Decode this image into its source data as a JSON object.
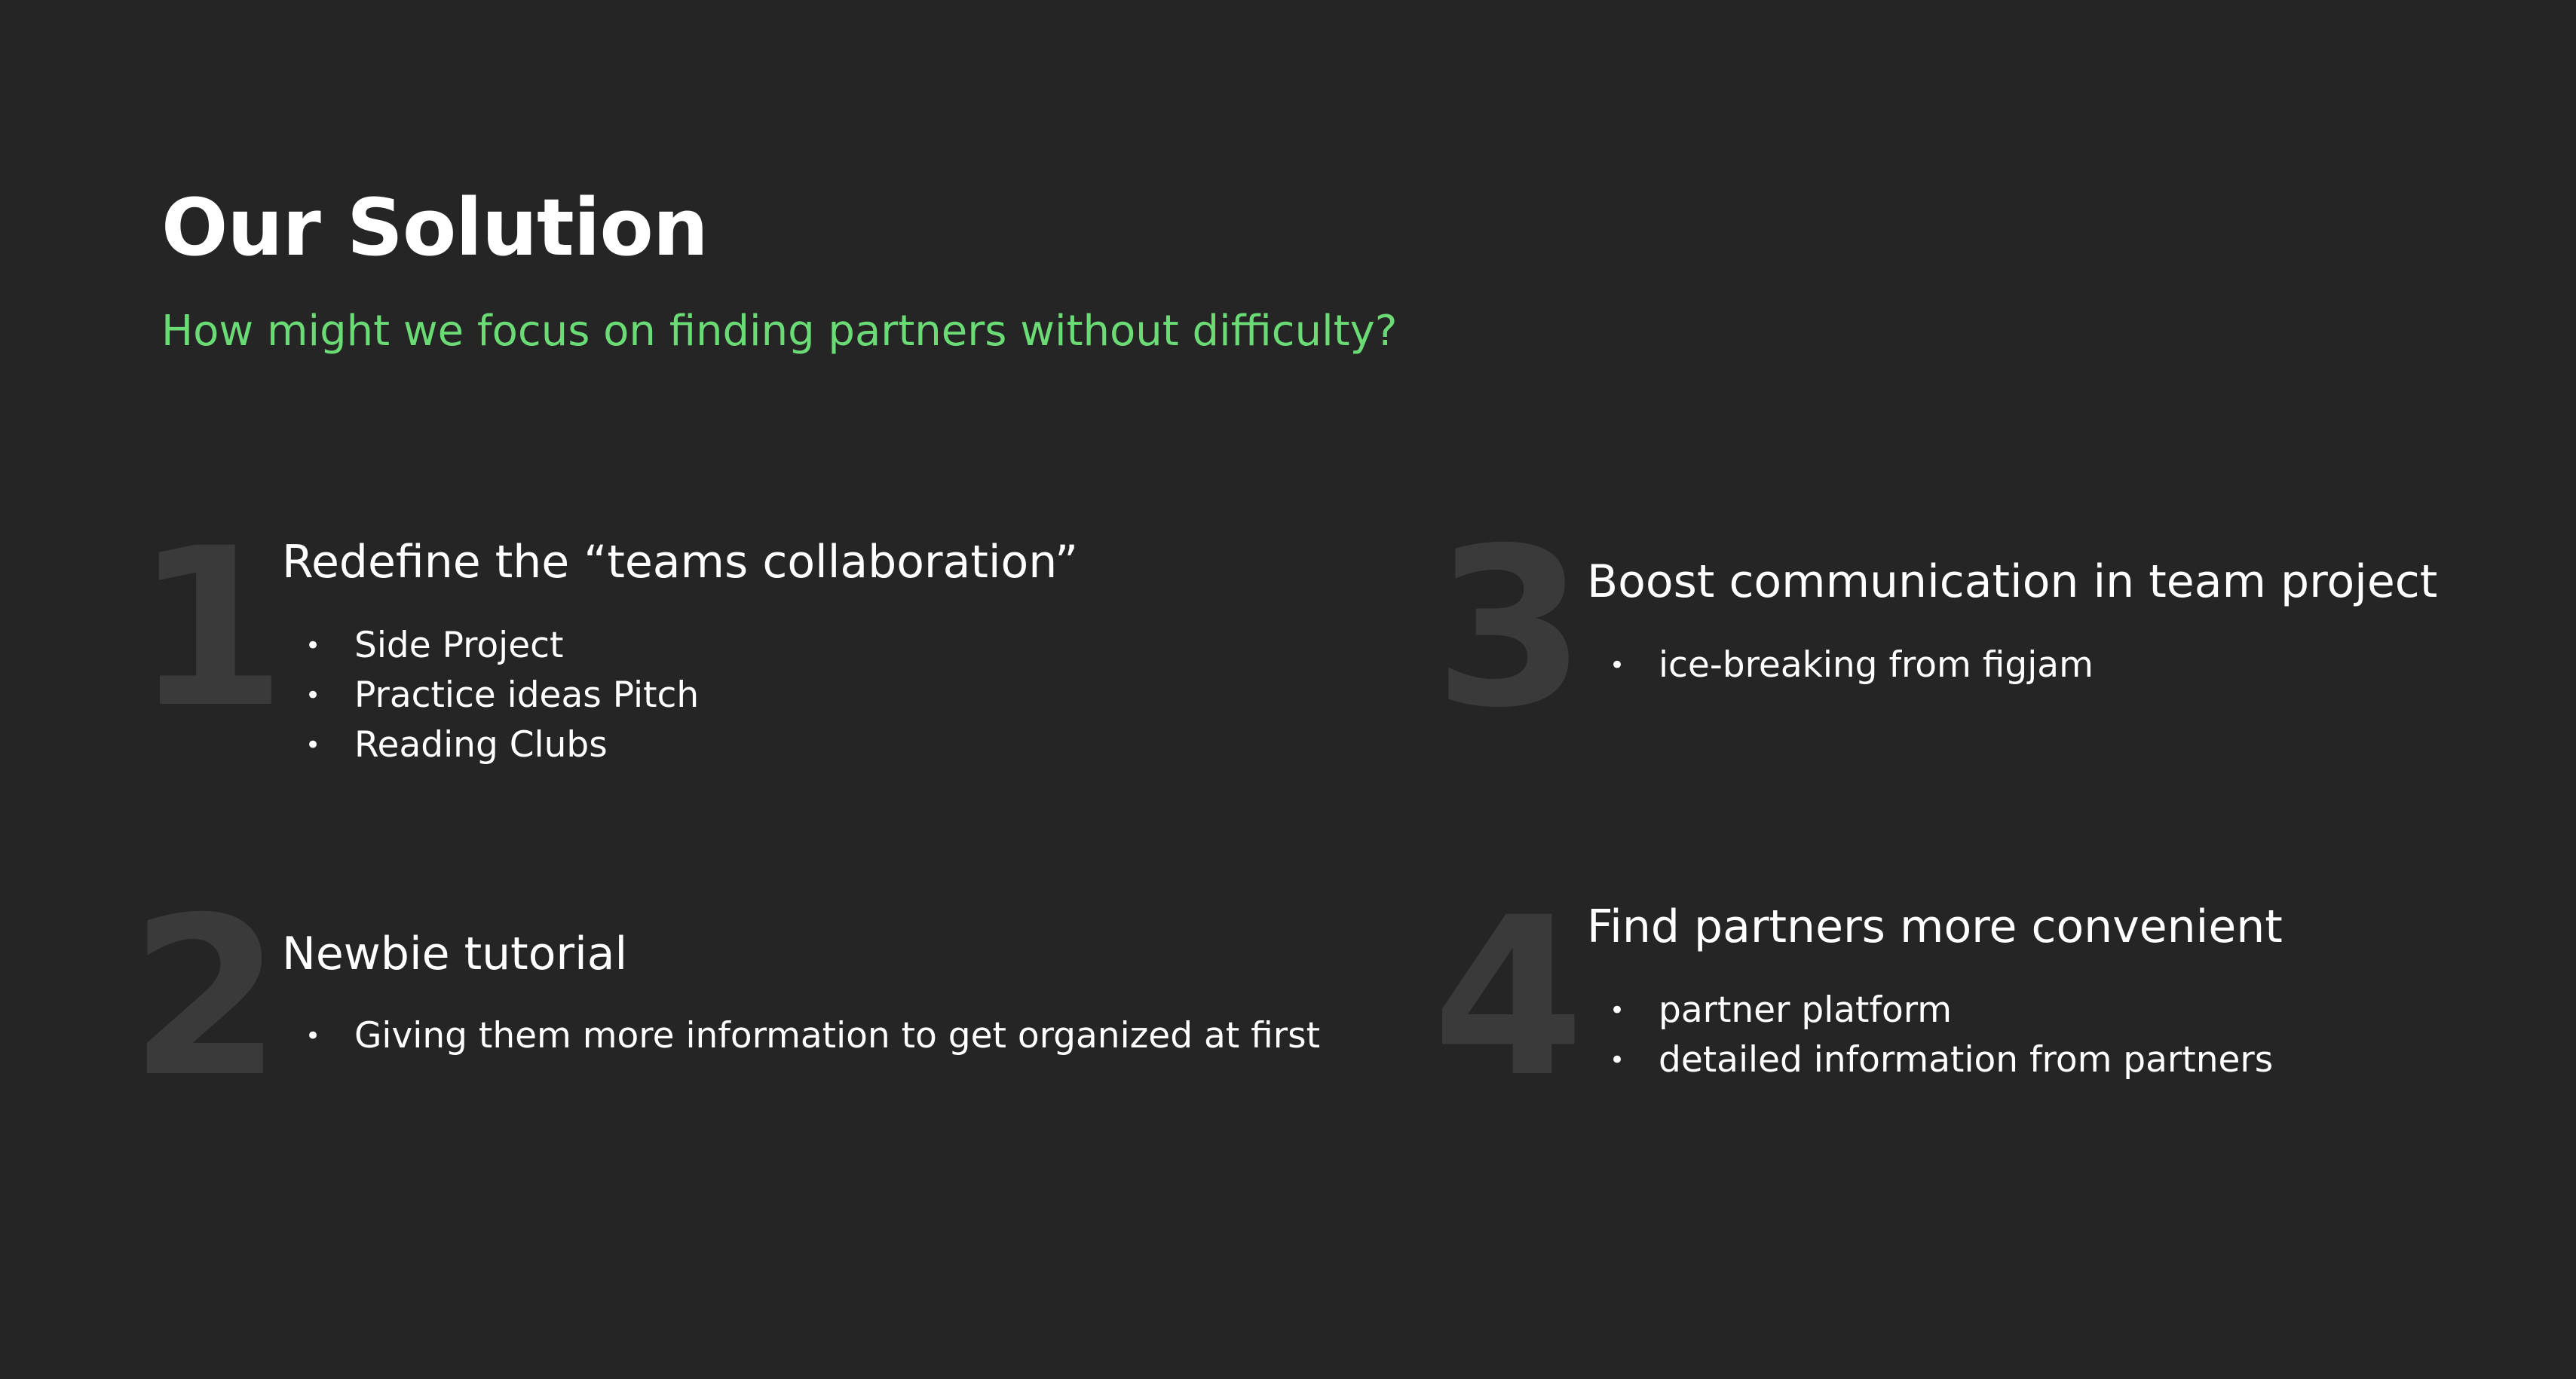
{
  "slide": {
    "title": "Our Solution",
    "subtitle": "How might we focus on finding partners without difficulty?",
    "accent_color": "#6bdb76",
    "background_color": "#252525",
    "number_color": "#3a3a3a"
  },
  "items": [
    {
      "number": "1",
      "heading": "Redefine the “teams collaboration”",
      "bullets": [
        "Side Project",
        "Practice ideas Pitch",
        "Reading Clubs"
      ]
    },
    {
      "number": "2",
      "heading": "Newbie tutorial",
      "bullets": [
        "Giving them more information to  get organized at first"
      ]
    },
    {
      "number": "3",
      "heading": "Boost communication in team project",
      "bullets": [
        "ice-breaking from figjam"
      ]
    },
    {
      "number": "4",
      "heading": "Find partners more convenient",
      "bullets": [
        "partner platform",
        "detailed information from partners"
      ]
    }
  ],
  "bullet_glyph": "•"
}
